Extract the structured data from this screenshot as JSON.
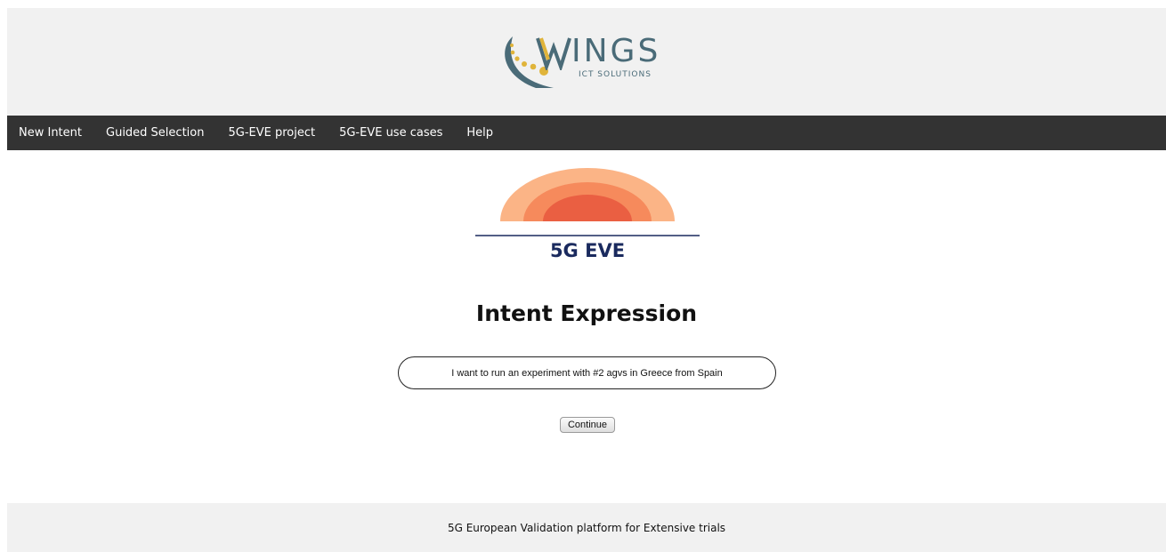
{
  "header": {
    "logo_word": "INGS",
    "logo_initial": "W",
    "logo_subtitle": "ICT SOLUTIONS",
    "logo_icon": "wings-swoosh-logo",
    "colors": {
      "logo_text": "#4a6b78",
      "logo_dots": "#e0b43a",
      "background": "#f1f1f1"
    }
  },
  "nav": {
    "items": [
      {
        "label": "New Intent"
      },
      {
        "label": "Guided Selection"
      },
      {
        "label": "5G-EVE project"
      },
      {
        "label": "5G-EVE use cases"
      },
      {
        "label": "Help"
      }
    ],
    "background": "#333333"
  },
  "project_logo": {
    "text": "5G EVE",
    "icon": "5g-eve-arc-logo",
    "colors": {
      "text": "#1a2a5e",
      "arc_outer": "#f9a06d",
      "arc_inner": "#e9553f"
    }
  },
  "main": {
    "title": "Intent Expression",
    "intent_value": "I want to run an experiment with #2 agvs in Greece from Spain",
    "continue_label": "Continue"
  },
  "footer": {
    "text": "5G European Validation platform for Extensive trials"
  }
}
